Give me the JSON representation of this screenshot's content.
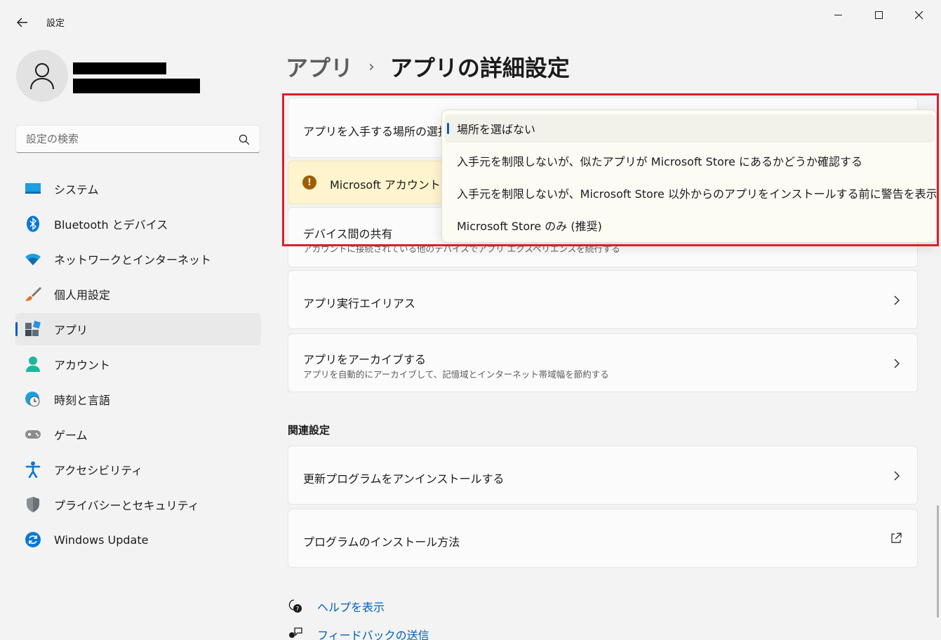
{
  "window": {
    "title": "設定"
  },
  "search": {
    "placeholder": "設定の検索"
  },
  "nav": {
    "items": [
      {
        "label": "システム",
        "icon": "system-icon"
      },
      {
        "label": "Bluetooth とデバイス",
        "icon": "bluetooth-icon"
      },
      {
        "label": "ネットワークとインターネット",
        "icon": "wifi-icon"
      },
      {
        "label": "個人用設定",
        "icon": "brush-icon"
      },
      {
        "label": "アプリ",
        "icon": "apps-icon",
        "selected": true
      },
      {
        "label": "アカウント",
        "icon": "account-icon"
      },
      {
        "label": "時刻と言語",
        "icon": "time-language-icon"
      },
      {
        "label": "ゲーム",
        "icon": "gamepad-icon"
      },
      {
        "label": "アクセシビリティ",
        "icon": "accessibility-icon"
      },
      {
        "label": "プライバシーとセキュリティ",
        "icon": "shield-icon"
      },
      {
        "label": "Windows Update",
        "icon": "update-icon"
      }
    ]
  },
  "breadcrumb": {
    "parent": "アプリ",
    "separator": "›",
    "current": "アプリの詳細設定"
  },
  "settings": {
    "choose_source_label": "アプリを入手する場所の選択",
    "warning_text": "Microsoft アカウントで",
    "share_title": "デバイス間の共有",
    "share_sub": "アカウントに接続されている他のデバイスでアプリ エクスペリエンスを続行する",
    "alias_title": "アプリ実行エイリアス",
    "archive_title": "アプリをアーカイブする",
    "archive_sub": "アプリを自動的にアーカイブして、記憶域とインターネット帯域幅を節約する"
  },
  "related": {
    "heading": "関連設定",
    "uninstall_updates": "更新プログラムをアンインストールする",
    "install_method": "プログラムのインストール方法"
  },
  "links": {
    "help": "ヘルプを表示",
    "feedback": "フィードバックの送信"
  },
  "dropdown": {
    "options": [
      {
        "label": "場所を選ばない",
        "selected": true
      },
      {
        "label": "入手元を制限しないが、似たアプリが Microsoft Store にあるかどうか確認する"
      },
      {
        "label": "入手元を制限しないが、Microsoft Store 以外からのアプリをインストールする前に警告を表示する"
      },
      {
        "label": "Microsoft Store のみ (推奨)"
      }
    ]
  },
  "colors": {
    "accent": "#005fb8",
    "highlight": "#d9202b",
    "warning_bg": "#fff4ce"
  }
}
